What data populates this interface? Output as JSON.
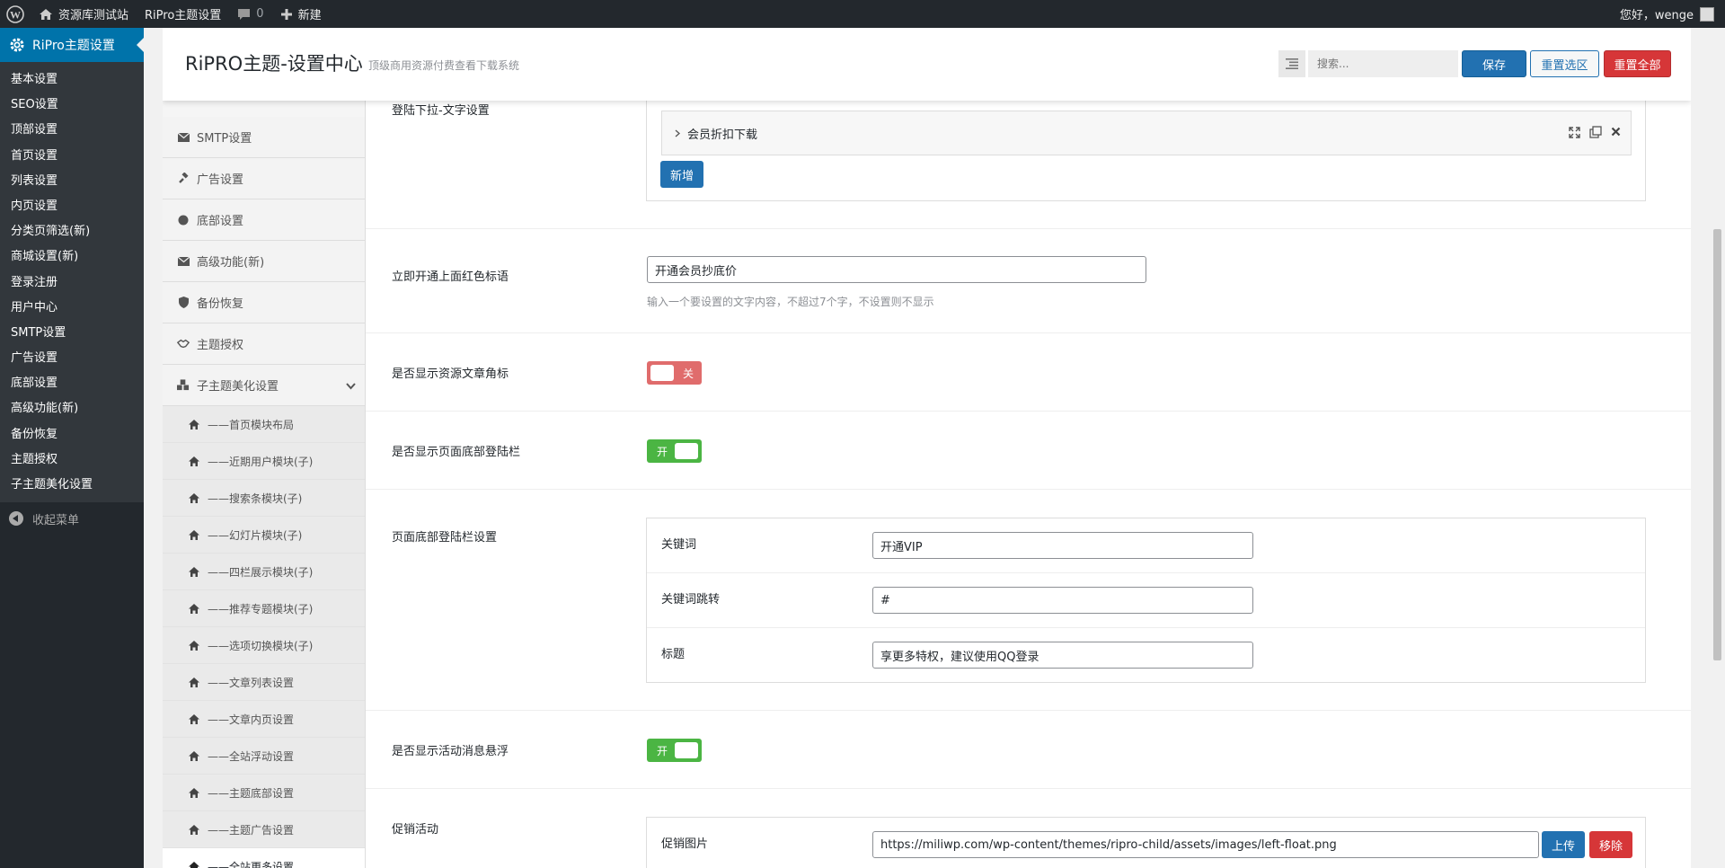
{
  "adminbar": {
    "site_name": "资源库测试站",
    "theme_settings": "RiPro主题设置",
    "comments_count": "0",
    "new_label": "新建",
    "greeting": "您好，wenge"
  },
  "adminmenu": {
    "current": "RiPro主题设置",
    "items": [
      "基本设置",
      "SEO设置",
      "顶部设置",
      "首页设置",
      "列表设置",
      "内页设置",
      "分类页筛选(新)",
      "商城设置(新)",
      "登录注册",
      "用户中心",
      "SMTP设置",
      "广告设置",
      "底部设置",
      "高级功能(新)",
      "备份恢复",
      "主题授权",
      "子主题美化设置"
    ],
    "collapse": "收起菜单"
  },
  "panel": {
    "title": "RiPRO主题-设置中心",
    "subtitle": "顶级商用资源付费查看下载系统",
    "search_placeholder": "搜索...",
    "save": "保存",
    "reset_section": "重置选区",
    "reset_all": "重置全部"
  },
  "nav": {
    "items": [
      {
        "label": "SMTP设置",
        "icon": "envelope-icon"
      },
      {
        "label": "广告设置",
        "icon": "gavel-icon"
      },
      {
        "label": "底部设置",
        "icon": "circle-icon"
      },
      {
        "label": "高级功能(新)",
        "icon": "envelope-icon"
      },
      {
        "label": "备份恢复",
        "icon": "shield-icon"
      },
      {
        "label": "主题授权",
        "icon": "handshake-icon"
      },
      {
        "label": "子主题美化设置",
        "icon": "cubes-icon"
      }
    ],
    "sub_items": [
      "——首页模块布局",
      "——近期用户模块(子)",
      "——搜索条模块(子)",
      "——幻灯片模块(子)",
      "——四栏展示模块(子)",
      "——推荐专题模块(子)",
      "——选项切换模块(子)",
      "——文章列表设置",
      "——文章内页设置",
      "——全站浮动设置",
      "——主题底部设置",
      "——主题广告设置",
      "——全站更多设置"
    ]
  },
  "fields": {
    "login_dropdown": {
      "label": "登陆下拉-文字设置",
      "group_item": "会员折扣下载",
      "add_button": "新增"
    },
    "red_slogan": {
      "label": "立即开通上面红色标语",
      "value": "开通会员抄底价",
      "desc": "输入一个要设置的文字内容，不超过7个字，不设置则不显示"
    },
    "show_corner_badge": {
      "label": "是否显示资源文章角标",
      "state": "关"
    },
    "show_footer_login": {
      "label": "是否显示页面底部登陆栏",
      "state": "开"
    },
    "footer_login_settings": {
      "label": "页面底部登陆栏设置",
      "rows": [
        {
          "label": "关键词",
          "value": "开通VIP"
        },
        {
          "label": "关键词跳转",
          "value": "#"
        },
        {
          "label": "标题",
          "value": "享更多特权，建议使用QQ登录"
        }
      ]
    },
    "show_activity_float": {
      "label": "是否显示活动消息悬浮",
      "state": "开"
    },
    "promotion": {
      "label": "促销活动",
      "image_label": "促销图片",
      "image_url": "https://miliwp.com/wp-content/themes/ripro-child/assets/images/left-float.png",
      "upload": "上传",
      "remove": "移除"
    }
  },
  "colors": {
    "wp_dark": "#23282d",
    "wp_blue": "#0073aa",
    "primary_button": "#2271b1",
    "danger": "#d63638",
    "switch_on": "#4bb543",
    "switch_off": "#e06c6c"
  }
}
